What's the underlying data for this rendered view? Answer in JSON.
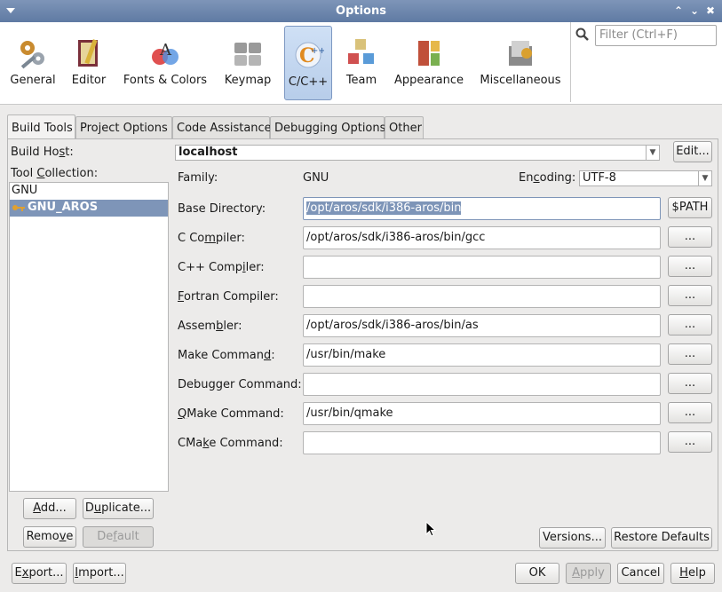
{
  "window": {
    "title": "Options"
  },
  "categories": [
    {
      "label": "General",
      "icon": "gears-icon"
    },
    {
      "label": "Editor",
      "icon": "editor-icon"
    },
    {
      "label": "Fonts & Colors",
      "icon": "fonts-colors-icon"
    },
    {
      "label": "Keymap",
      "icon": "keymap-icon"
    },
    {
      "label": "C/C++",
      "icon": "cpp-icon"
    },
    {
      "label": "Team",
      "icon": "team-icon"
    },
    {
      "label": "Appearance",
      "icon": "appearance-icon"
    },
    {
      "label": "Miscellaneous",
      "icon": "miscellaneous-icon"
    }
  ],
  "filter": {
    "placeholder": "Filter (Ctrl+F)"
  },
  "tabs": [
    "Build Tools",
    "Project Options",
    "Code Assistance",
    "Debugging Options",
    "Other"
  ],
  "build_host": {
    "label_pre": "Build Ho",
    "label_u": "s",
    "label_post": "t:",
    "value": "localhost",
    "edit": "Edit..."
  },
  "tool_collection": {
    "label_pre": "Tool ",
    "label_u": "C",
    "label_post": "ollection:",
    "items": [
      "GNU",
      "GNU_AROS"
    ]
  },
  "family": {
    "label": "Family:",
    "value": "GNU"
  },
  "encoding": {
    "label_pre": "En",
    "label_u": "c",
    "label_post": "oding:",
    "value": "UTF-8"
  },
  "rows": {
    "base_dir": {
      "label": "Base Directory:",
      "value": "/opt/aros/sdk/i386-aros/bin",
      "button": "$PATH"
    },
    "c_compiler": {
      "pre": "C Co",
      "u": "m",
      "post": "piler:",
      "value": "/opt/aros/sdk/i386-aros/bin/gcc",
      "button": "..."
    },
    "cpp_compiler": {
      "pre": "C++ Comp",
      "u": "i",
      "post": "ler:",
      "value": "",
      "button": "..."
    },
    "fortran": {
      "pre": "",
      "u": "F",
      "post": "ortran Compiler:",
      "value": "",
      "button": "..."
    },
    "assembler": {
      "pre": "Assem",
      "u": "b",
      "post": "ler:",
      "value": "/opt/aros/sdk/i386-aros/bin/as",
      "button": "..."
    },
    "make": {
      "pre": "Make Comman",
      "u": "d",
      "post": ":",
      "value": "/usr/bin/make",
      "button": "..."
    },
    "debugger": {
      "label": "Debugger Command:",
      "value": "",
      "button": "..."
    },
    "qmake": {
      "pre": "",
      "u": "Q",
      "post": "Make Command:",
      "value": "/usr/bin/qmake",
      "button": "..."
    },
    "cmake": {
      "pre": "CMa",
      "u": "k",
      "post": "e Command:",
      "value": "",
      "button": "..."
    }
  },
  "collection_buttons": {
    "add": {
      "pre": "",
      "u": "A",
      "post": "dd..."
    },
    "duplicate": {
      "pre": "D",
      "u": "u",
      "post": "plicate..."
    },
    "remove": {
      "pre": "Remo",
      "u": "v",
      "post": "e"
    },
    "default": {
      "pre": "De",
      "u": "f",
      "post": "ault"
    }
  },
  "panel_buttons": {
    "versions": "Versions...",
    "restore": "Restore Defaults"
  },
  "footer": {
    "export": {
      "pre": "E",
      "u": "x",
      "post": "port..."
    },
    "import": {
      "pre": "",
      "u": "I",
      "post": "mport..."
    },
    "ok": "OK",
    "apply": {
      "pre": "",
      "u": "A",
      "post": "pply"
    },
    "cancel": "Cancel",
    "help": {
      "pre": "",
      "u": "H",
      "post": "elp"
    }
  },
  "colors": {
    "titlebar": "#6e87ae",
    "selection": "#7e95b8"
  }
}
